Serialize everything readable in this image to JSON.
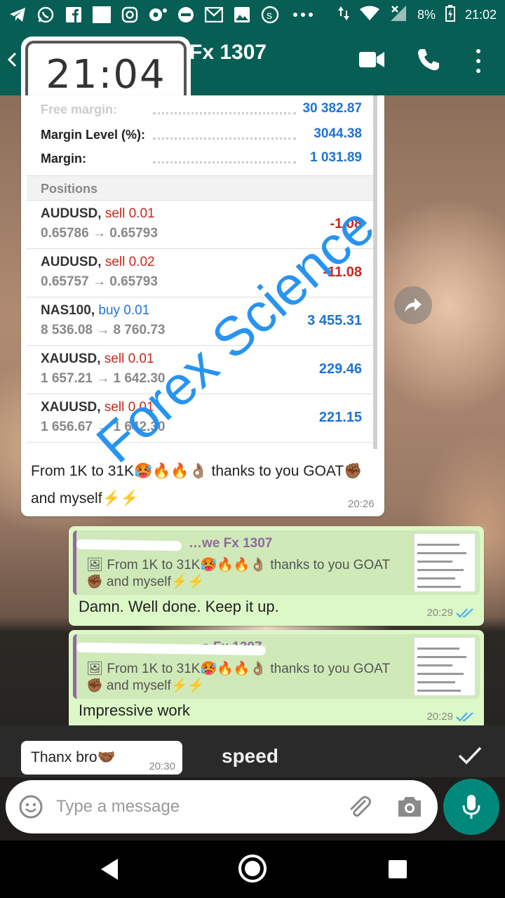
{
  "status_bar": {
    "battery": "8%",
    "time": "21:02",
    "icons": [
      "telegram-icon",
      "whatsapp-icon",
      "facebook-icon",
      "image-icon",
      "instagram-icon",
      "notification-icon",
      "dnd-icon",
      "gmail-icon",
      "gallery-icon",
      "skype-icon",
      "more-icon",
      "data-icon",
      "wifi-icon",
      "signal-icon",
      "battery-icon"
    ]
  },
  "header": {
    "title": "Fx 1307",
    "overlay_clock": "21:04"
  },
  "account": {
    "rows": [
      {
        "label": "Free margin:",
        "value": "30 382.87"
      },
      {
        "label": "Margin Level (%):",
        "value": "3044.38"
      },
      {
        "label": "Margin:",
        "value": "1 031.89"
      }
    ],
    "positions_label": "Positions"
  },
  "positions": [
    {
      "symbol": "AUDUSD,",
      "side": "sell 0.01",
      "prices": "0.65786 → 0.65793",
      "profit": "-1.08"
    },
    {
      "symbol": "AUDUSD,",
      "side": "sell 0.02",
      "prices": "0.65757 → 0.65793",
      "profit": "-11.08"
    },
    {
      "symbol": "NAS100,",
      "side": "buy 0.01",
      "prices": "8 536.08 → 8 760.73",
      "profit": "3 455.31"
    },
    {
      "symbol": "XAUUSD,",
      "side": "sell 0.01",
      "prices": "1 657.21 → 1 642.30",
      "profit": "229.46"
    },
    {
      "symbol": "XAUUSD,",
      "side": "sell 0.01",
      "prices": "1 656.67 → 1 642.30",
      "profit": "221.15"
    }
  ],
  "incoming": {
    "caption": "From 1K to 31K🥵🔥🔥👌🏽  thanks to you GOAT✊🏾 and myself⚡⚡",
    "time": "20:26"
  },
  "watermark": "Forex Science",
  "outgoing": [
    {
      "quote_name": "…we Fx 1307",
      "quote_text": "🖼 From 1K to 31K🥵🔥🔥👌🏽  thanks to you GOAT ✊🏾 and myself⚡⚡",
      "message": "Damn. Well done. Keep it up.",
      "time": "20:29"
    },
    {
      "quote_name": "…a Fx 1307",
      "quote_text": "🖼 From 1K to 31K🥵🔥🔥👌🏽  thanks to you GOAT ✊🏾 and myself⚡⚡",
      "message": "Impressive work",
      "time": "20:29"
    }
  ],
  "reply": {
    "message": "Thanx bro🤝🏾",
    "time": "20:30"
  },
  "quick_bar": {
    "label": "speed"
  },
  "composer": {
    "placeholder": "Type a message"
  },
  "colors": {
    "header": "#075e54",
    "outgoing_bubble": "#dcf8c6",
    "accent": "#00897b",
    "watermark": "#1e8ff0"
  }
}
